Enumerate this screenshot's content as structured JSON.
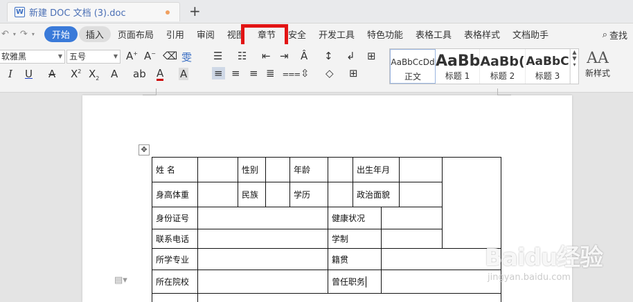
{
  "tab": {
    "title": "新建 DOC 文档 (3).doc",
    "new_tab": "+",
    "icon_letter": "W"
  },
  "menu": {
    "items": [
      "开始",
      "插入",
      "页面布局",
      "引用",
      "审阅",
      "视图",
      "章节",
      "安全",
      "开发工具",
      "特色功能",
      "表格工具",
      "表格样式",
      "文档助手"
    ],
    "active": "开始",
    "search": "查找"
  },
  "ribbon": {
    "font_name": "软雅黑",
    "font_size": "五号",
    "styles": [
      {
        "sample": "AaBbCcDd",
        "name": "正文"
      },
      {
        "sample": "AaBb",
        "name": "标题 1"
      },
      {
        "sample": "AaBb(",
        "name": "标题 2"
      },
      {
        "sample": "AaBbC",
        "name": "标题 3"
      }
    ],
    "new_style": "新样式",
    "new_style_icon": "AA",
    "font_color": "#cc0000",
    "underline_color": "#1a3fc9"
  },
  "table": {
    "rows": [
      [
        "姓  名",
        "",
        "性别",
        "",
        "年龄",
        "",
        "出生年月",
        "",
        ""
      ],
      [
        "身高体重",
        "",
        "民族",
        "",
        "学历",
        "",
        "政治面貌",
        ""
      ],
      [
        "身份证号",
        "",
        "健康状况",
        ""
      ],
      [
        "联系电话",
        "",
        "学制",
        ""
      ],
      [
        "所学专业",
        "",
        "籍贯",
        ""
      ],
      [
        "所在院校",
        "",
        "曾任职务",
        ""
      ],
      [
        "",
        ""
      ]
    ]
  },
  "watermark": {
    "main": "Baidu经验",
    "sub": "jingyan.baidu.com"
  },
  "colors": {
    "accent": "#3a7ad9",
    "highlight": "#e21414"
  }
}
